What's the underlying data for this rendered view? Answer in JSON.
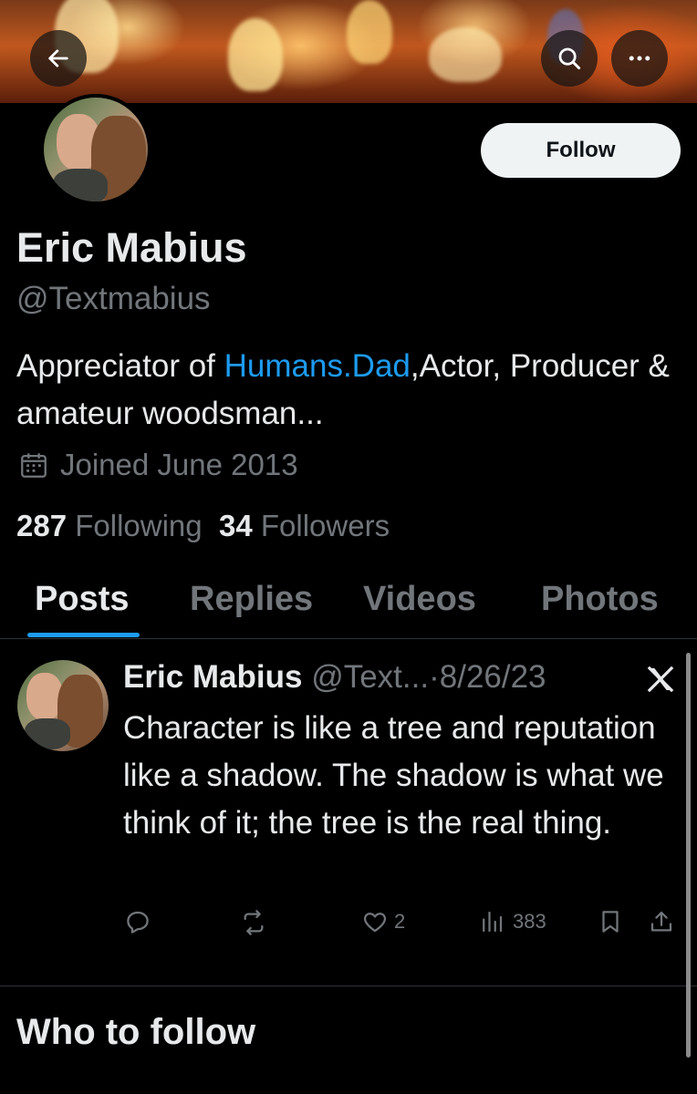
{
  "header": {
    "back_icon": "arrow-left-icon",
    "search_icon": "search-icon",
    "more_icon": "more-horizontal-icon"
  },
  "profile": {
    "name": "Eric Mabius",
    "handle": "@Textmabius",
    "follow_label": "Follow",
    "bio_prefix": "Appreciator of ",
    "bio_link": "Humans.Dad",
    "bio_suffix": ",Actor, Producer & amateur woodsman...",
    "joined": "Joined June 2013",
    "following_count": "287",
    "following_label": "Following",
    "followers_count": "34",
    "followers_label": "Followers"
  },
  "tabs": [
    {
      "label": "Posts",
      "active": true
    },
    {
      "label": "Replies",
      "active": false
    },
    {
      "label": "Videos",
      "active": false
    },
    {
      "label": "Photos",
      "active": false
    }
  ],
  "post": {
    "name": "Eric Mabius",
    "handle": "@Text...",
    "separator": "·",
    "date": "8/26/23",
    "text": "Character is like a tree and reputation like a shadow. The shadow is what we think of it; the tree is the real thing.",
    "likes": "2",
    "views": "383"
  },
  "section": {
    "who_to_follow": "Who to follow"
  },
  "colors": {
    "accent": "#1d9bf0",
    "background": "#000000",
    "text": "#e7e9ea",
    "muted": "#71767b"
  }
}
